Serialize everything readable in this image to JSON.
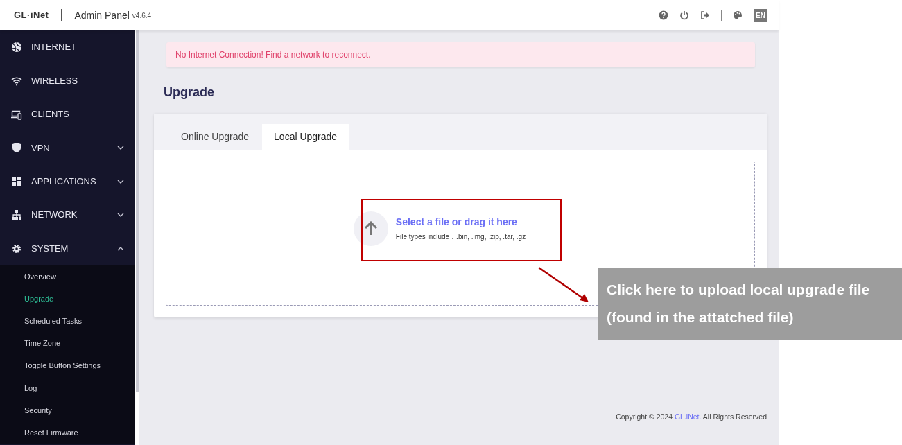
{
  "header": {
    "logo": "GL·iNet",
    "title": "Admin Panel",
    "version": "v4.6.4",
    "language": "EN"
  },
  "sidebar": {
    "items": [
      {
        "label": "INTERNET"
      },
      {
        "label": "WIRELESS"
      },
      {
        "label": "CLIENTS"
      },
      {
        "label": "VPN",
        "expanded": false
      },
      {
        "label": "APPLICATIONS",
        "expanded": false
      },
      {
        "label": "NETWORK",
        "expanded": false
      },
      {
        "label": "SYSTEM",
        "expanded": true,
        "children": [
          {
            "label": "Overview",
            "selected": false
          },
          {
            "label": "Upgrade",
            "selected": true
          },
          {
            "label": "Scheduled Tasks",
            "selected": false
          },
          {
            "label": "Time Zone",
            "selected": false
          },
          {
            "label": "Toggle Button Settings",
            "selected": false
          },
          {
            "label": "Log",
            "selected": false
          },
          {
            "label": "Security",
            "selected": false
          },
          {
            "label": "Reset Firmware",
            "selected": false
          }
        ]
      }
    ]
  },
  "alert": "No Internet Connection! Find a network to reconnect.",
  "page_title": "Upgrade",
  "tabs": [
    {
      "label": "Online Upgrade",
      "selected": false
    },
    {
      "label": "Local Upgrade",
      "selected": true
    }
  ],
  "upload": {
    "title": "Select a file or drag it here",
    "hint": "File types include：.bin, .img, .zip, .tar, .gz"
  },
  "footer": {
    "before": "Copyright © 2024 ",
    "link": "GL.iNet.",
    "after": " All Rights Reserved"
  },
  "annotation": {
    "text": "Click here to upload local upgrade file (found in the attatched file)"
  }
}
